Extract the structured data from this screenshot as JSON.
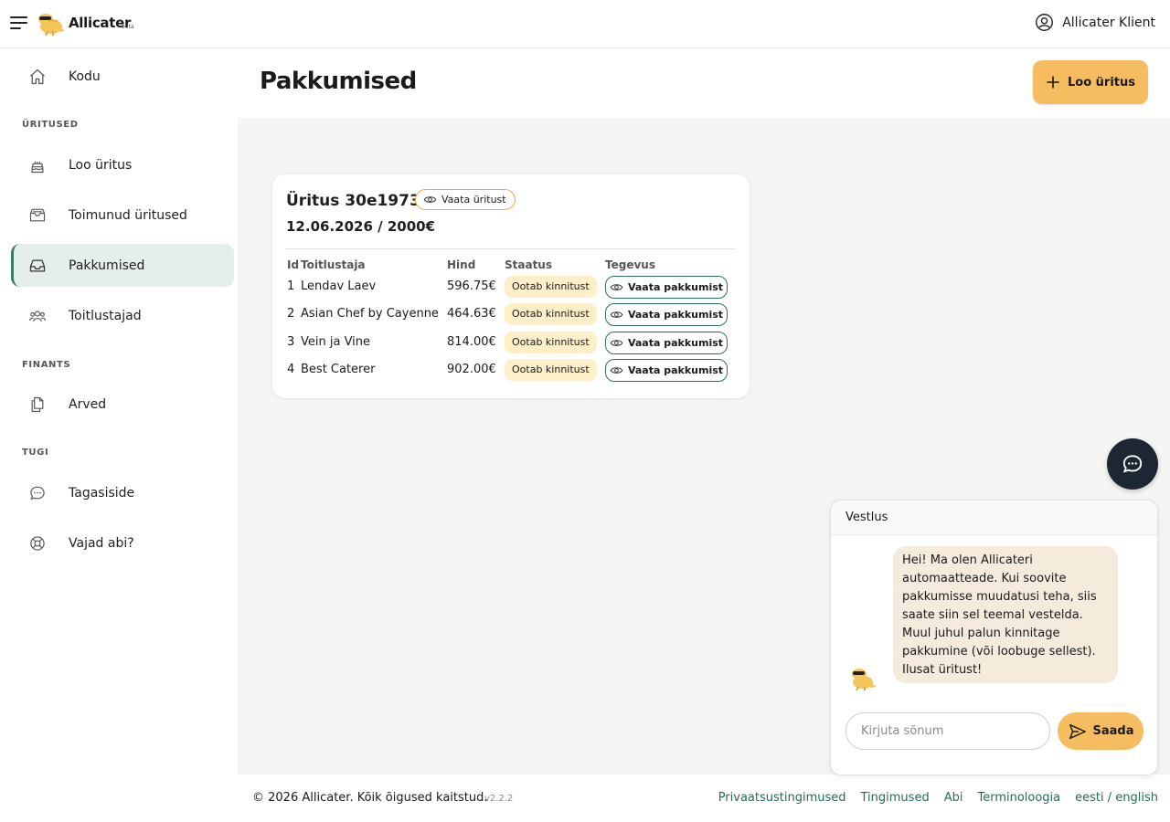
{
  "header": {
    "brand": "Allicater",
    "beta": "beta",
    "user_name": "Allicater Klient"
  },
  "sidebar": {
    "home": "Kodu",
    "section_events": "ÜRITUSED",
    "create_event": "Loo üritus",
    "past_events": "Toimunud üritused",
    "offers": "Pakkumised",
    "caterers": "Toitlustajad",
    "section_finance": "FINANTS",
    "invoices": "Arved",
    "section_support": "TUGI",
    "feedback": "Tagasiside",
    "help": "Vajad abi?"
  },
  "main": {
    "title": "Pakkumised",
    "create_button": "Loo üritus"
  },
  "event": {
    "title": "Üritus 30e19738",
    "view_button": "Vaata üritust",
    "subtitle": "12.06.2026 / 2000€",
    "columns": {
      "id": "Id",
      "caterer": "Toitlustaja",
      "price": "Hind",
      "status": "Staatus",
      "action": "Tegevus"
    },
    "offers": [
      {
        "id": "1",
        "caterer": "Lendav Laev",
        "price": "596.75€",
        "status": "Ootab kinnitust",
        "action": "Vaata pakkumist"
      },
      {
        "id": "2",
        "caterer": "Asian Chef by Cayenne",
        "price": "464.63€",
        "status": "Ootab kinnitust",
        "action": "Vaata pakkumist"
      },
      {
        "id": "3",
        "caterer": "Vein ja Vine",
        "price": "814.00€",
        "status": "Ootab kinnitust",
        "action": "Vaata pakkumist"
      },
      {
        "id": "4",
        "caterer": "Best Caterer",
        "price": "902.00€",
        "status": "Ootab kinnitust",
        "action": "Vaata pakkumist"
      }
    ]
  },
  "chat": {
    "title": "Vestlus",
    "message": "Hei! Ma olen Allicateri automaatteade. Kui soovite pakkumisse muudatusi teha, siis saate siin sel teemal vestelda. Muul juhul palun kinnitage pakkumine (või loobuge sellest). Ilusat üritust!",
    "input_placeholder": "Kirjuta sõnum",
    "send_label": "Saada"
  },
  "footer": {
    "copyright": "© 2026 Allicater. Kõik õigused kaitstud.",
    "version": "v2.2.2",
    "links": [
      "Privaatsustingimused",
      "Tingimused",
      "Abi",
      "Terminoloogia",
      "eesti / english"
    ]
  },
  "colors": {
    "accent": "#f5bd5f",
    "active_nav": "#e4eeea",
    "active_nav_border": "#3d7a66",
    "status_badge": "#fdf0c9",
    "link": "#2a6a55",
    "chat_bubble": "#f5ebdc",
    "chat_fab": "#1c2733"
  }
}
